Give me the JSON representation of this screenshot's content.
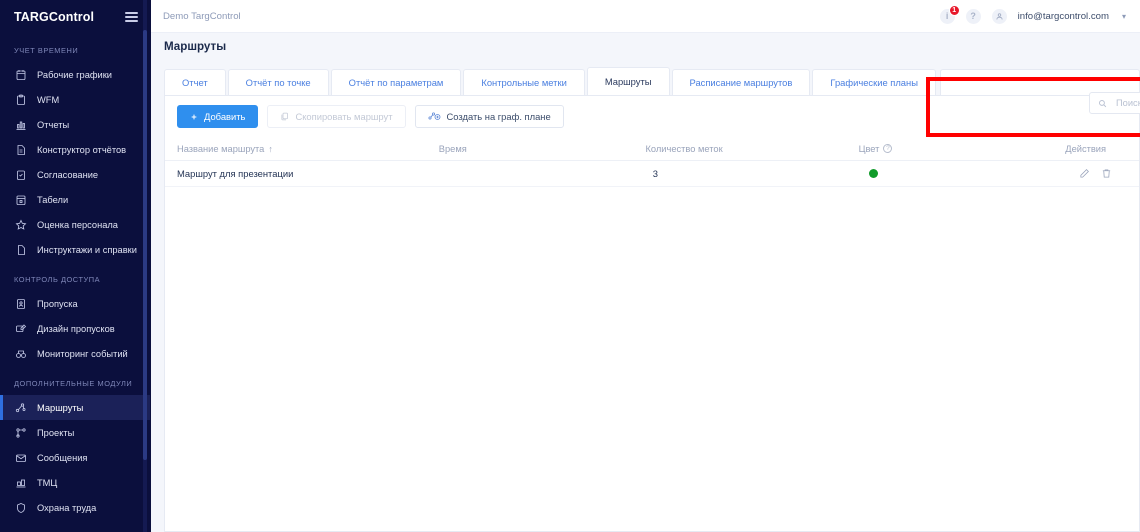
{
  "sidebar": {
    "brand": "TARGControl",
    "menu_icon": "hamburger-icon",
    "sections": [
      {
        "title": "УЧЕТ ВРЕМЕНИ",
        "items": [
          {
            "label": "Рабочие графики",
            "icon": "calendar-icon",
            "active": false
          },
          {
            "label": "WFM",
            "icon": "clipboard-icon",
            "active": false
          },
          {
            "label": "Отчеты",
            "icon": "bar-chart-icon",
            "active": false
          },
          {
            "label": "Конструктор отчётов",
            "icon": "document-icon",
            "active": false
          },
          {
            "label": "Согласование",
            "icon": "checklist-icon",
            "active": false
          },
          {
            "label": "Табели",
            "icon": "calendar-grid-icon",
            "active": false
          },
          {
            "label": "Оценка персонала",
            "icon": "star-icon",
            "active": false
          },
          {
            "label": "Инструктажи и справки",
            "icon": "file-icon",
            "active": false
          }
        ]
      },
      {
        "title": "КОНТРОЛЬ ДОСТУПА",
        "items": [
          {
            "label": "Пропуска",
            "icon": "badge-icon",
            "active": false
          },
          {
            "label": "Дизайн пропусков",
            "icon": "card-design-icon",
            "active": false
          },
          {
            "label": "Мониторинг событий",
            "icon": "monitoring-icon",
            "active": false
          }
        ]
      },
      {
        "title": "ДОПОЛНИТЕЛЬНЫЕ МОДУЛИ",
        "items": [
          {
            "label": "Маршруты",
            "icon": "route-icon",
            "active": true
          },
          {
            "label": "Проекты",
            "icon": "project-tree-icon",
            "active": false
          },
          {
            "label": "Сообщения",
            "icon": "envelope-icon",
            "active": false
          },
          {
            "label": "ТМЦ",
            "icon": "inventory-icon",
            "active": false
          },
          {
            "label": "Охрана труда",
            "icon": "shield-icon",
            "active": false
          }
        ]
      }
    ]
  },
  "topbar": {
    "breadcrumb": "Demo TargControl",
    "info_icon": "info-icon",
    "notification_count": "1",
    "help_icon": "question-icon",
    "avatar_icon": "user-avatar-icon",
    "user_email": "info@targcontrol.com",
    "caret_icon": "chevron-down-icon"
  },
  "page": {
    "title": "Маршруты"
  },
  "tabs": [
    {
      "label": "Отчет",
      "active": false
    },
    {
      "label": "Отчёт по точке",
      "active": false
    },
    {
      "label": "Отчёт по параметрам",
      "active": false
    },
    {
      "label": "Контрольные метки",
      "active": false
    },
    {
      "label": "Маршруты",
      "active": true
    },
    {
      "label": "Расписание маршрутов",
      "active": false
    },
    {
      "label": "Графические планы",
      "active": false
    }
  ],
  "toolbar": {
    "add_label": "Добавить",
    "add_icon": "plus-icon",
    "copy_label": "Скопировать маршрут",
    "copy_icon": "copy-icon",
    "copy_disabled": true,
    "plan_label": "Создать на граф. плане",
    "plan_icon": "route-plus-icon"
  },
  "search": {
    "placeholder": "Поиск",
    "value": "",
    "icon": "search-icon"
  },
  "table": {
    "columns": [
      {
        "label": "Название маршрута",
        "sort": "↑"
      },
      {
        "label": "Время"
      },
      {
        "label": "Количество меток"
      },
      {
        "label": "Цвет",
        "info": "?"
      },
      {
        "label": "Действия"
      }
    ],
    "rows": [
      {
        "name": "Маршрут для презентации",
        "time": "",
        "count": "3",
        "color": "#119b2a",
        "edit_icon": "pencil-icon",
        "delete_icon": "trash-icon"
      }
    ]
  },
  "annotation": {
    "color": "#ff0000",
    "label": "search-highlight"
  }
}
